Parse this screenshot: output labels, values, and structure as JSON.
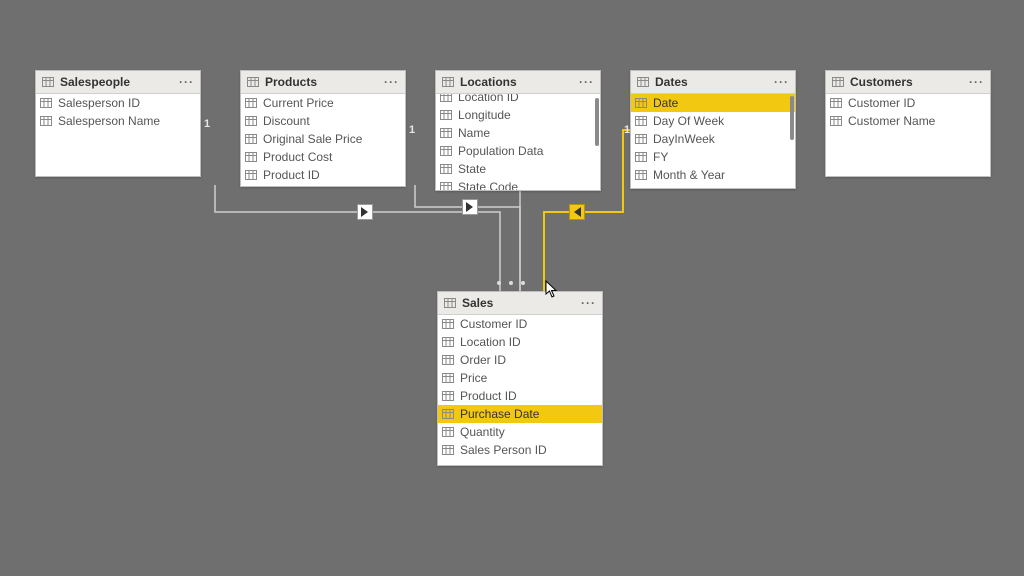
{
  "colors": {
    "canvas_bg": "#6f6f6f",
    "table_bg": "#ffffff",
    "header_bg": "#eceae7",
    "border": "#bfbfbf",
    "highlight": "#f2c811",
    "wire_default": "#cfcfcf",
    "wire_active": "#f2c811"
  },
  "cardinality": {
    "one_label": "1",
    "many_label": "*"
  },
  "tables": {
    "salespeople": {
      "title": "Salespeople",
      "fields": [
        "Salesperson ID",
        "Salesperson Name"
      ]
    },
    "products": {
      "title": "Products",
      "fields": [
        "Current Price",
        "Discount",
        "Original Sale Price",
        "Product Cost",
        "Product ID"
      ]
    },
    "locations": {
      "title": "Locations",
      "fields": [
        "Location ID",
        "Longitude",
        "Name",
        "Population Data",
        "State",
        "State Code"
      ]
    },
    "dates": {
      "title": "Dates",
      "fields": [
        "Date",
        "Day Of Week",
        "DayInWeek",
        "FY",
        "Month & Year"
      ],
      "selected_field": "Date"
    },
    "customers": {
      "title": "Customers",
      "fields": [
        "Customer ID",
        "Customer Name"
      ]
    },
    "sales": {
      "title": "Sales",
      "fields": [
        "Customer ID",
        "Location ID",
        "Order ID",
        "Price",
        "Product ID",
        "Purchase Date",
        "Quantity",
        "Sales Person ID"
      ],
      "selected_field": "Purchase Date"
    }
  },
  "relationships": [
    {
      "from": "salespeople",
      "to": "sales",
      "from_card": "1",
      "to_card": "*",
      "active": false
    },
    {
      "from": "products",
      "to": "sales",
      "from_card": "1",
      "to_card": "*",
      "active": false
    },
    {
      "from": "locations",
      "to": "sales",
      "from_card": "1",
      "to_card": "*",
      "active": false
    },
    {
      "from": "dates",
      "to": "sales",
      "from_card": "1",
      "to_card": "*",
      "active": true,
      "via_fields": [
        "Date",
        "Purchase Date"
      ]
    }
  ],
  "header_menu_glyph": "···"
}
